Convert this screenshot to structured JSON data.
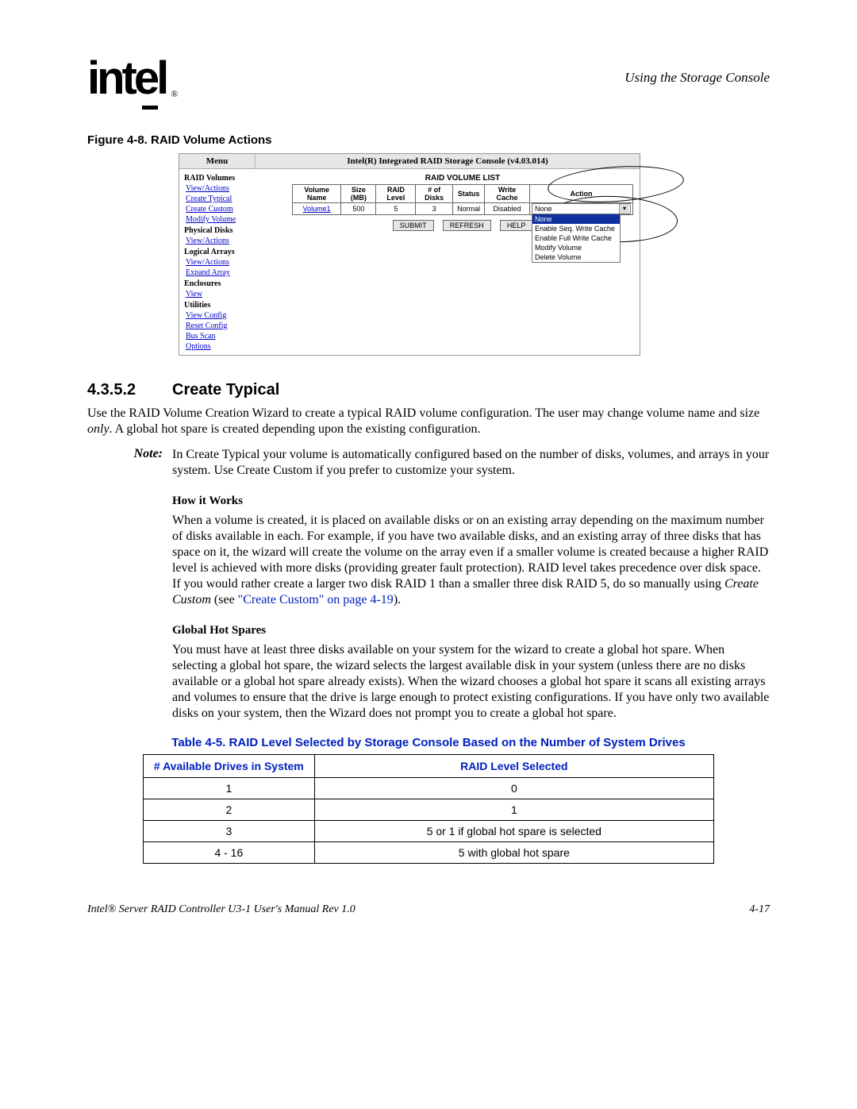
{
  "header": {
    "logo_text": "intel",
    "reg": "®",
    "right_text": "Using the Storage Console"
  },
  "figure": {
    "caption": "Figure 4-8. RAID Volume Actions",
    "menu_label": "Menu",
    "console_title": "Intel(R) Integrated RAID Storage Console (v4.03.014)",
    "sidebar": {
      "raid_volumes": "RAID Volumes",
      "va1": "View/Actions",
      "ct": "Create Typical",
      "cc": "Create Custom",
      "mv": "Modify Volume",
      "physical_disks": "Physical Disks",
      "va2": "View/Actions",
      "logical_arrays": "Logical Arrays",
      "va3": "View/Actions",
      "ea": "Expand Array",
      "enclosures": "Enclosures",
      "view": "View",
      "utilities": "Utilities",
      "vc": "View Config",
      "rc": "Reset Config",
      "bs": "Bus Scan",
      "op": "Options"
    },
    "list_title": "RAID VOLUME LIST",
    "table": {
      "h1": "Volume Name",
      "h2": "Size (MB)",
      "h3": "RAID Level",
      "h4": "# of Disks",
      "h5": "Status",
      "h6": "Write Cache",
      "h7": "Action",
      "r_name": "Volume1",
      "r_size": "500",
      "r_level": "5",
      "r_disks": "3",
      "r_status": "Normal",
      "r_cache": "Disabled",
      "r_action": "None"
    },
    "dropdown": {
      "o1": "None",
      "o2": "Enable Seq. Write Cache",
      "o3": "Enable Full Write Cache",
      "o4": "Modify Volume",
      "o5": "Delete Volume"
    },
    "buttons": {
      "submit": "SUBMIT",
      "refresh": "REFRESH",
      "help": "HELP"
    }
  },
  "section": {
    "num": "4.3.5.2",
    "title": "Create Typical",
    "p1a": "Use the RAID Volume Creation Wizard to create a typical RAID volume configuration. The user may change volume name and size ",
    "p1_only": "only",
    "p1b": ". A global hot spare is created depending upon the existing configuration.",
    "note_label": "Note:",
    "note_text": "In Create Typical your volume is automatically configured based on the number of disks, volumes, and arrays in your system. Use Create Custom if you prefer to customize your system.",
    "howit": "How it Works",
    "p2a": "When a volume is created, it is placed on available disks or on an existing array depending on the maximum number of disks available in each. For example, if you have two available disks, and an existing array of three disks that has space on it, the wizard will create the volume on the array even if a smaller volume is created because a higher RAID level is achieved with more disks (providing greater fault protection). RAID level takes precedence over disk space. If you would rather create a larger two disk RAID 1 than a smaller three disk RAID 5, do so manually using ",
    "p2_cc": "Create Custom",
    "p2c": " (see ",
    "p2_xref": "\"Create Custom\" on page 4-19",
    "p2d": ").",
    "ghs": "Global Hot Spares",
    "p3": "You must have at least three disks available on your system for the wizard to create a global hot spare. When selecting a global hot spare, the wizard selects the largest available disk in your system (unless there are no disks available or a global hot spare already exists). When the wizard chooses a global hot spare it scans all existing arrays and volumes to ensure that the drive is large enough to protect existing configurations. If you have only two available disks on your system, then the Wizard does not prompt you to create a global hot spare."
  },
  "table45": {
    "caption": "Table 4-5. RAID Level Selected by Storage Console Based on the Number of System Drives",
    "h1": "# Available Drives in System",
    "h2": "RAID Level Selected",
    "rows": [
      {
        "a": "1",
        "b": "0"
      },
      {
        "a": "2",
        "b": "1"
      },
      {
        "a": "3",
        "b": "5 or 1 if global hot spare is selected"
      },
      {
        "a": "4 - 16",
        "b": "5 with global hot spare"
      }
    ]
  },
  "footer": {
    "left": "Intel® Server RAID Controller U3-1 User's Manual Rev 1.0",
    "right": "4-17"
  }
}
